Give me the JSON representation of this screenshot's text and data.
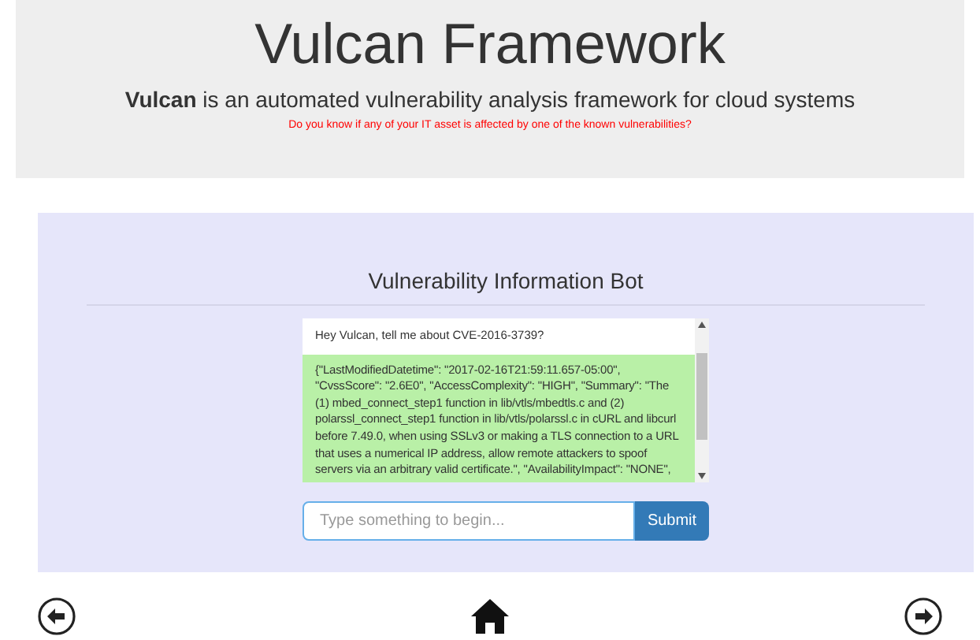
{
  "header": {
    "title": "Vulcan Framework",
    "tagline": "**Vulcan** is an automated vulnerability analysis framework for cloud systems",
    "question": "Do you know if any of your IT asset is affected by one of the known vulnerabilities?"
  },
  "bot": {
    "title": "Vulnerability Information Bot",
    "messages": [
      {
        "kind": "user",
        "text": "Hey Vulcan, tell me about CVE-2016-3739?"
      },
      {
        "kind": "bot",
        "text": "{\"LastModifiedDatetime\": \"2017-02-16T21:59:11.657-05:00\", \"CvssScore\": \"2.6E0\", \"AccessComplexity\": \"HIGH\", \"Summary\": \"The (1) mbed_connect_step1 function in lib/vtls/mbedtls.c and (2) polarssl_connect_step1 function in lib/vtls/polarssl.c in cURL and libcurl before 7.49.0, when using SSLv3 or making a TLS connection to a URL that uses a numerical IP address, allow remote attackers to spoof servers via an arbitrary valid certificate.\", \"AvailabilityImpact\": \"NONE\","
      }
    ],
    "input": {
      "placeholder": "Type something to begin..."
    },
    "submit": "Submit"
  }
}
